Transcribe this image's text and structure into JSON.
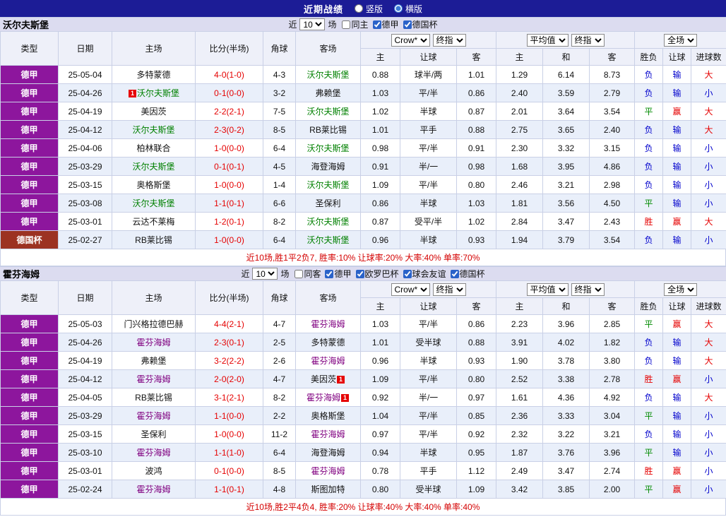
{
  "topbar": {
    "title": "近期战绩",
    "vertical_label": "竖版",
    "horizontal_label": "横版"
  },
  "labels": {
    "near": "近",
    "count": "10",
    "games": "场"
  },
  "table": {
    "cols": [
      "类型",
      "日期",
      "主场",
      "比分(半场)",
      "角球",
      "客场"
    ],
    "selects": {
      "crow": "Crow*",
      "final": "终指",
      "avg": "平均值",
      "full": "全场"
    },
    "sub": [
      "主",
      "让球",
      "客",
      "主",
      "和",
      "客",
      "胜负",
      "让球",
      "进球数"
    ]
  },
  "colors": {
    "topbar_bg": "#1c1c96",
    "league_badge": "#8d169d",
    "cup_badge": "#9c3222",
    "win": "#e50000",
    "draw": "#008a00",
    "lose": "#0000cc",
    "score": "#e50000",
    "team1_highlight": "#008000",
    "team2_highlight": "#800080"
  },
  "sections": [
    {
      "team": "沃尔夫斯堡",
      "hl_color": "#008000",
      "filters": [
        {
          "label": "同主",
          "checked": false
        },
        {
          "label": "德甲",
          "checked": true
        },
        {
          "label": "德国杯",
          "checked": true
        }
      ],
      "rows": [
        {
          "league": "德甲",
          "date": "25-05-04",
          "home": "多特蒙德",
          "score": "4-0(1-0)",
          "corner": "4-3",
          "away": "沃尔夫斯堡",
          "away_hl": true,
          "crown": [
            "0.88",
            "球半/两",
            "1.01"
          ],
          "avg": [
            "1.29",
            "6.14",
            "8.73"
          ],
          "result": "负",
          "handicap": "输",
          "goals": "大"
        },
        {
          "league": "德甲",
          "date": "25-04-26",
          "home": "沃尔夫斯堡",
          "home_hl": true,
          "home_card": "pre",
          "score": "0-1(0-0)",
          "corner": "3-2",
          "away": "弗赖堡",
          "crown": [
            "1.03",
            "平/半",
            "0.86"
          ],
          "avg": [
            "2.40",
            "3.59",
            "2.79"
          ],
          "result": "负",
          "handicap": "输",
          "goals": "小"
        },
        {
          "league": "德甲",
          "date": "25-04-19",
          "home": "美因茨",
          "score": "2-2(2-1)",
          "corner": "7-5",
          "away": "沃尔夫斯堡",
          "away_hl": true,
          "crown": [
            "1.02",
            "半球",
            "0.87"
          ],
          "avg": [
            "2.01",
            "3.64",
            "3.54"
          ],
          "result": "平",
          "handicap": "赢",
          "goals": "大"
        },
        {
          "league": "德甲",
          "date": "25-04-12",
          "home": "沃尔夫斯堡",
          "home_hl": true,
          "score": "2-3(0-2)",
          "corner": "8-5",
          "away": "RB莱比锡",
          "crown": [
            "1.01",
            "平手",
            "0.88"
          ],
          "avg": [
            "2.75",
            "3.65",
            "2.40"
          ],
          "result": "负",
          "handicap": "输",
          "goals": "大"
        },
        {
          "league": "德甲",
          "date": "25-04-06",
          "home": "柏林联合",
          "score": "1-0(0-0)",
          "corner": "6-4",
          "away": "沃尔夫斯堡",
          "away_hl": true,
          "crown": [
            "0.98",
            "平/半",
            "0.91"
          ],
          "avg": [
            "2.30",
            "3.32",
            "3.15"
          ],
          "result": "负",
          "handicap": "输",
          "goals": "小"
        },
        {
          "league": "德甲",
          "date": "25-03-29",
          "home": "沃尔夫斯堡",
          "home_hl": true,
          "score": "0-1(0-1)",
          "corner": "4-5",
          "away": "海登海姆",
          "crown": [
            "0.91",
            "半/一",
            "0.98"
          ],
          "avg": [
            "1.68",
            "3.95",
            "4.86"
          ],
          "result": "负",
          "handicap": "输",
          "goals": "小"
        },
        {
          "league": "德甲",
          "date": "25-03-15",
          "home": "奥格斯堡",
          "score": "1-0(0-0)",
          "corner": "1-4",
          "away": "沃尔夫斯堡",
          "away_hl": true,
          "crown": [
            "1.09",
            "平/半",
            "0.80"
          ],
          "avg": [
            "2.46",
            "3.21",
            "2.98"
          ],
          "result": "负",
          "handicap": "输",
          "goals": "小"
        },
        {
          "league": "德甲",
          "date": "25-03-08",
          "home": "沃尔夫斯堡",
          "home_hl": true,
          "score": "1-1(0-1)",
          "corner": "6-6",
          "away": "圣保利",
          "crown": [
            "0.86",
            "半球",
            "1.03"
          ],
          "avg": [
            "1.81",
            "3.56",
            "4.50"
          ],
          "result": "平",
          "handicap": "输",
          "goals": "小"
        },
        {
          "league": "德甲",
          "date": "25-03-01",
          "home": "云达不莱梅",
          "score": "1-2(0-1)",
          "corner": "8-2",
          "away": "沃尔夫斯堡",
          "away_hl": true,
          "crown": [
            "0.87",
            "受平/半",
            "1.02"
          ],
          "avg": [
            "2.84",
            "3.47",
            "2.43"
          ],
          "result": "胜",
          "handicap": "赢",
          "goals": "大"
        },
        {
          "league": "德国杯",
          "cup": true,
          "date": "25-02-27",
          "home": "RB莱比锡",
          "score": "1-0(0-0)",
          "corner": "6-4",
          "away": "沃尔夫斯堡",
          "away_hl": true,
          "crown": [
            "0.96",
            "半球",
            "0.93"
          ],
          "avg": [
            "1.94",
            "3.79",
            "3.54"
          ],
          "result": "负",
          "handicap": "输",
          "goals": "小"
        }
      ],
      "summary": "近10场,胜1平2负7, 胜率:10% 让球率:20% 大率:40% 单率:70%"
    },
    {
      "team": "霍芬海姆",
      "hl_color": "#800080",
      "filters": [
        {
          "label": "同客",
          "checked": false
        },
        {
          "label": "德甲",
          "checked": true
        },
        {
          "label": "欧罗巴杯",
          "checked": true
        },
        {
          "label": "球会友谊",
          "checked": true
        },
        {
          "label": "德国杯",
          "checked": true
        }
      ],
      "rows": [
        {
          "league": "德甲",
          "date": "25-05-03",
          "home": "门兴格拉德巴赫",
          "score": "4-4(2-1)",
          "corner": "4-7",
          "away": "霍芬海姆",
          "away_hl": true,
          "crown": [
            "1.03",
            "平/半",
            "0.86"
          ],
          "avg": [
            "2.23",
            "3.96",
            "2.85"
          ],
          "result": "平",
          "handicap": "赢",
          "goals": "大"
        },
        {
          "league": "德甲",
          "date": "25-04-26",
          "home": "霍芬海姆",
          "home_hl": true,
          "score": "2-3(0-1)",
          "corner": "2-5",
          "away": "多特蒙德",
          "crown": [
            "1.01",
            "受半球",
            "0.88"
          ],
          "avg": [
            "3.91",
            "4.02",
            "1.82"
          ],
          "result": "负",
          "handicap": "输",
          "goals": "大"
        },
        {
          "league": "德甲",
          "date": "25-04-19",
          "home": "弗赖堡",
          "score": "3-2(2-2)",
          "corner": "2-6",
          "away": "霍芬海姆",
          "away_hl": true,
          "crown": [
            "0.96",
            "半球",
            "0.93"
          ],
          "avg": [
            "1.90",
            "3.78",
            "3.80"
          ],
          "result": "负",
          "handicap": "输",
          "goals": "大"
        },
        {
          "league": "德甲",
          "date": "25-04-12",
          "home": "霍芬海姆",
          "home_hl": true,
          "score": "2-0(2-0)",
          "corner": "4-7",
          "away": "美因茨",
          "away_card": "post",
          "crown": [
            "1.09",
            "平/半",
            "0.80"
          ],
          "avg": [
            "2.52",
            "3.38",
            "2.78"
          ],
          "result": "胜",
          "handicap": "赢",
          "goals": "小"
        },
        {
          "league": "德甲",
          "date": "25-04-05",
          "home": "RB莱比锡",
          "score": "3-1(2-1)",
          "corner": "8-2",
          "away": "霍芬海姆",
          "away_hl": true,
          "away_card": "post",
          "crown": [
            "0.92",
            "半/一",
            "0.97"
          ],
          "avg": [
            "1.61",
            "4.36",
            "4.92"
          ],
          "result": "负",
          "handicap": "输",
          "goals": "大"
        },
        {
          "league": "德甲",
          "date": "25-03-29",
          "home": "霍芬海姆",
          "home_hl": true,
          "score": "1-1(0-0)",
          "corner": "2-2",
          "away": "奥格斯堡",
          "crown": [
            "1.04",
            "平/半",
            "0.85"
          ],
          "avg": [
            "2.36",
            "3.33",
            "3.04"
          ],
          "result": "平",
          "handicap": "输",
          "goals": "小"
        },
        {
          "league": "德甲",
          "date": "25-03-15",
          "home": "圣保利",
          "score": "1-0(0-0)",
          "corner": "11-2",
          "away": "霍芬海姆",
          "away_hl": true,
          "crown": [
            "0.97",
            "平/半",
            "0.92"
          ],
          "avg": [
            "2.32",
            "3.22",
            "3.21"
          ],
          "result": "负",
          "handicap": "输",
          "goals": "小"
        },
        {
          "league": "德甲",
          "date": "25-03-10",
          "home": "霍芬海姆",
          "home_hl": true,
          "score": "1-1(1-0)",
          "corner": "6-4",
          "away": "海登海姆",
          "crown": [
            "0.94",
            "半球",
            "0.95"
          ],
          "avg": [
            "1.87",
            "3.76",
            "3.96"
          ],
          "result": "平",
          "handicap": "输",
          "goals": "小"
        },
        {
          "league": "德甲",
          "date": "25-03-01",
          "home": "波鸿",
          "score": "0-1(0-0)",
          "corner": "8-5",
          "away": "霍芬海姆",
          "away_hl": true,
          "crown": [
            "0.78",
            "平手",
            "1.12"
          ],
          "avg": [
            "2.49",
            "3.47",
            "2.74"
          ],
          "result": "胜",
          "handicap": "赢",
          "goals": "小"
        },
        {
          "league": "德甲",
          "date": "25-02-24",
          "home": "霍芬海姆",
          "home_hl": true,
          "score": "1-1(0-1)",
          "corner": "4-8",
          "away": "斯图加特",
          "crown": [
            "0.80",
            "受半球",
            "1.09"
          ],
          "avg": [
            "3.42",
            "3.85",
            "2.00"
          ],
          "result": "平",
          "handicap": "赢",
          "goals": "小"
        }
      ],
      "summary": "近10场,胜2平4负4, 胜率:20% 让球率:40% 大率:40% 单率:40%"
    }
  ]
}
